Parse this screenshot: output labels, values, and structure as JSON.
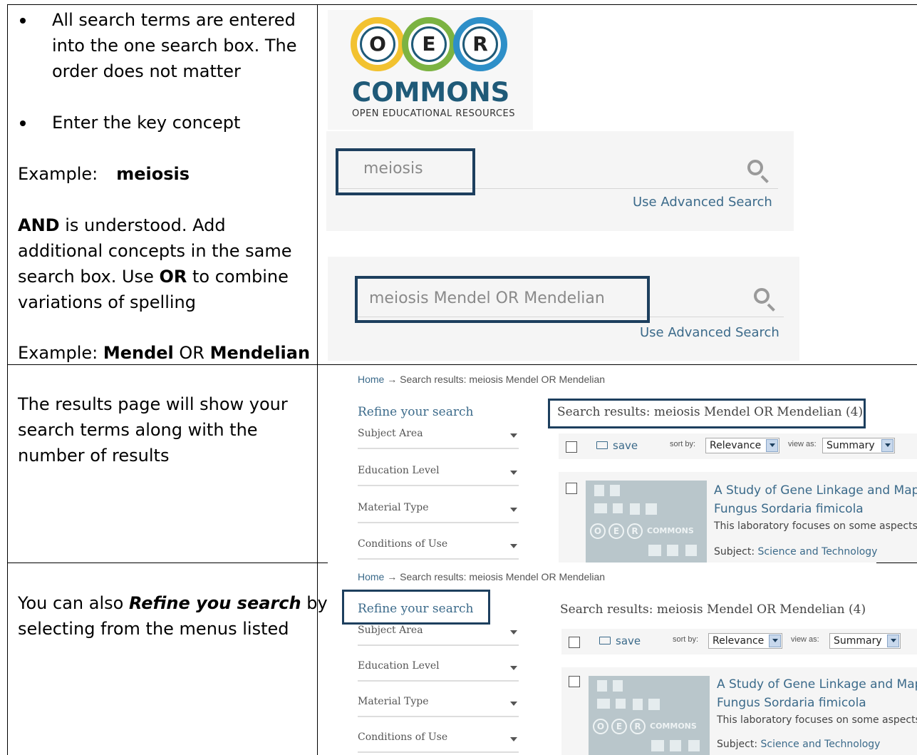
{
  "row1": {
    "bullet1": "All search terms are entered into the one search box. The order does not matter",
    "bullet1_lines": [
      "All search terms are entered",
      "into the one search box. The",
      "order does not matter"
    ],
    "bullet2": "Enter the key concept",
    "example1_label": "Example:",
    "example1_term": "meiosis",
    "and_bold": "AND",
    "and_rest1": " is understood. Add",
    "and_line2": "additional concepts in the same",
    "and_line3_pre": "search box. Use ",
    "or_bold": "OR",
    "and_line3_post": " to combine",
    "and_line4": "variations of spelling",
    "example2_label": "Example: ",
    "example2_term1": "Mendel",
    "example2_or": " OR ",
    "example2_term2": "Mendelian"
  },
  "row2": {
    "lines": [
      "The results page will show your",
      "search terms along with the",
      "number of results"
    ]
  },
  "row3": {
    "pre": "You can also ",
    "em": "Refine you search",
    "post": " by",
    "line2": "selecting from the menus listed"
  },
  "logo": {
    "letters": [
      "O",
      "E",
      "R"
    ],
    "ring_colors": [
      "#f2c230",
      "#7cb342",
      "#2e8fc8"
    ],
    "name": "COMMONS",
    "sub": "OPEN EDUCATIONAL RESOURCES"
  },
  "search1": {
    "value": "meiosis",
    "advanced": "Use Advanced Search"
  },
  "search2": {
    "value": "meiosis Mendel OR Mendelian",
    "advanced": "Use Advanced Search"
  },
  "results": {
    "breadcrumb_home": "Home",
    "breadcrumb_arrow": " → ",
    "breadcrumb_rest": "Search results: meiosis Mendel OR Mendelian",
    "refine": "Refine your search",
    "facets": [
      "Subject Area",
      "Education Level",
      "Material Type",
      "Conditions of Use"
    ],
    "title": "Search results: meiosis Mendel OR Mendelian (4)",
    "save": "save",
    "sort_label": "sort by:",
    "sort_value": "Relevance",
    "view_label": "view as:",
    "view_value": "Summary",
    "item": {
      "title_line1": "A Study of Gene Linkage and Map",
      "title_line2": "Fungus Sordaria fimicola",
      "desc": "This laboratory focuses on some aspects",
      "subject_label": "Subject: ",
      "subject_value": "Science and Technology"
    },
    "thumb_text": "COMMONS"
  },
  "colors": {
    "accent": "#1d3f5e",
    "link": "#3b6a8a"
  }
}
